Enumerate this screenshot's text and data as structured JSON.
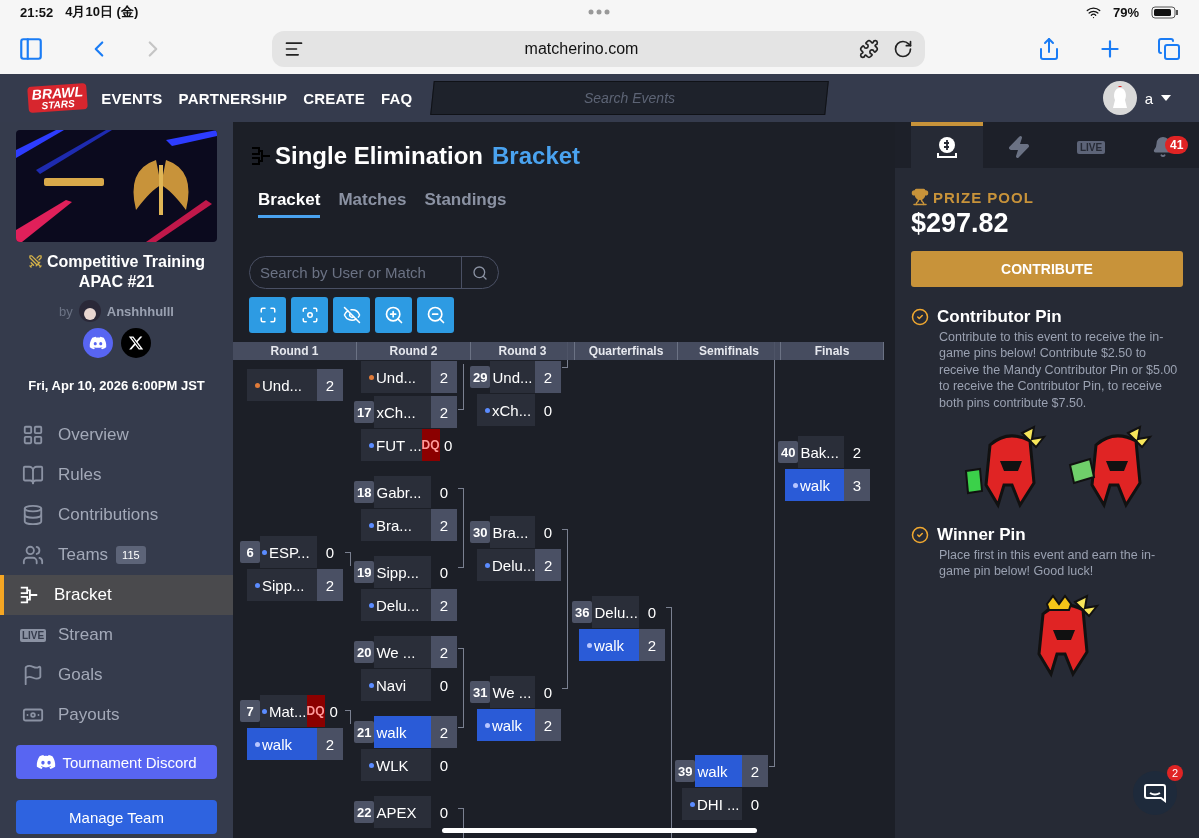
{
  "status_bar": {
    "time": "21:52",
    "date": "4月10日 (金)",
    "battery": "79%"
  },
  "browser": {
    "url": "matcherino.com"
  },
  "nav": {
    "logo": [
      "BRAWL",
      "STARS"
    ],
    "links": [
      "EVENTS",
      "PARTNERSHIP",
      "CREATE",
      "FAQ"
    ],
    "search": {
      "placeholder": "Search Events"
    },
    "user": "a"
  },
  "sidebar": {
    "event_title": "Competitive Training APAC #21",
    "by": "by",
    "organizer": "Anshhhulll",
    "date": "Fri, Apr 10, 2026 6:00PM JST",
    "items": [
      {
        "label": "Overview",
        "selected": false
      },
      {
        "label": "Rules",
        "selected": false
      },
      {
        "label": "Contributions",
        "selected": false
      },
      {
        "label": "Teams",
        "badge": "115",
        "selected": false
      },
      {
        "label": "Bracket",
        "selected": true
      },
      {
        "label": "Stream",
        "icon_text": "LIVE",
        "selected": false
      },
      {
        "label": "Goals",
        "selected": false
      },
      {
        "label": "Payouts",
        "selected": false
      }
    ],
    "buttons": [
      {
        "label": "Tournament Discord",
        "kind": "discord"
      },
      {
        "label": "Manage Team",
        "kind": "primary"
      }
    ]
  },
  "bracket": {
    "title": "Single Elimination",
    "title_accent": "Bracket",
    "tabs": [
      {
        "label": "Bracket",
        "selected": true
      },
      {
        "label": "Matches",
        "selected": false
      },
      {
        "label": "Standings",
        "selected": false
      }
    ],
    "search": {
      "placeholder": "Search by User or Match"
    },
    "rounds": [
      {
        "name": "Round 1",
        "matches": [
          {
            "rows": [
              {
                "team": "Und...",
                "score": "2",
                "color": "#e07b39",
                "winner": true,
                "highlighted": false
              }
            ]
          },
          {
            "number": "6",
            "rows": [
              {
                "team": "ESP...",
                "score": "0",
                "color": "#5b8cff",
                "winner": false,
                "highlighted": false
              },
              {
                "team": "Sipp...",
                "score": "2",
                "color": "#5b8cff",
                "winner": true,
                "highlighted": false
              }
            ]
          },
          {
            "number": "7",
            "rows": [
              {
                "team": "Mat...",
                "score": "0",
                "color": "#5b8cff",
                "winner": false,
                "highlighted": false,
                "tag": "DQ"
              },
              {
                "team": "walk",
                "score": "2",
                "color": "#b8c6ff",
                "winner": true,
                "highlighted": true
              }
            ]
          }
        ]
      },
      {
        "name": "Round 2",
        "matches": [
          {
            "rows": [
              {
                "team": "Und...",
                "score": "2",
                "color": "#e07b39",
                "winner": true,
                "highlighted": false
              }
            ]
          },
          {
            "number": "17",
            "rows": [
              {
                "team": "xCh...",
                "score": "2",
                "winner": true,
                "highlighted": false
              },
              {
                "team": "FUT ...",
                "score": "0",
                "color": "#5b8cff",
                "winner": false,
                "highlighted": false,
                "tag": "DQ"
              }
            ]
          },
          {
            "number": "18",
            "rows": [
              {
                "team": "Gabr...",
                "score": "0",
                "winner": false,
                "highlighted": false
              },
              {
                "team": "Bra...",
                "score": "2",
                "color": "#5b8cff",
                "winner": true,
                "highlighted": false
              }
            ]
          },
          {
            "number": "19",
            "rows": [
              {
                "team": "Sipp...",
                "score": "0",
                "winner": false,
                "highlighted": false
              },
              {
                "team": "Delu...",
                "score": "2",
                "color": "#5b8cff",
                "winner": true,
                "highlighted": false
              }
            ]
          },
          {
            "number": "20",
            "rows": [
              {
                "team": "We ...",
                "score": "2",
                "winner": true,
                "highlighted": false
              },
              {
                "team": "Navi",
                "score": "0",
                "color": "#5b8cff",
                "winner": false,
                "highlighted": false
              }
            ]
          },
          {
            "number": "21",
            "rows": [
              {
                "team": "walk",
                "score": "2",
                "winner": true,
                "highlighted": true
              },
              {
                "team": "WLK",
                "score": "0",
                "color": "#5b8cff",
                "winner": false,
                "highlighted": false
              }
            ]
          },
          {
            "number": "22",
            "rows": [
              {
                "team": "APEX",
                "score": "0",
                "winner": false,
                "highlighted": false
              }
            ]
          }
        ]
      },
      {
        "name": "Round 3",
        "matches": [
          {
            "number": "29",
            "rows": [
              {
                "team": "Und...",
                "score": "2",
                "winner": true,
                "highlighted": false
              },
              {
                "team": "xCh...",
                "score": "0",
                "color": "#5b8cff",
                "winner": false,
                "highlighted": false
              }
            ]
          },
          {
            "number": "30",
            "rows": [
              {
                "team": "Bra...",
                "score": "0",
                "winner": false,
                "highlighted": false
              },
              {
                "team": "Delu...",
                "score": "2",
                "color": "#5b8cff",
                "winner": true,
                "highlighted": false
              }
            ]
          },
          {
            "number": "31",
            "rows": [
              {
                "team": "We ...",
                "score": "0",
                "winner": false,
                "highlighted": false
              },
              {
                "team": "walk",
                "score": "2",
                "color": "#b8c6ff",
                "winner": true,
                "highlighted": true
              }
            ]
          }
        ]
      },
      {
        "name": "Quarterfinals",
        "matches": [
          {
            "number": "36",
            "rows": [
              {
                "team": "Delu...",
                "score": "0",
                "winner": false,
                "highlighted": false
              },
              {
                "team": "walk",
                "score": "2",
                "color": "#b8c6ff",
                "winner": true,
                "highlighted": true
              }
            ]
          }
        ]
      },
      {
        "name": "Semifinals",
        "matches": [
          {
            "number": "39",
            "rows": [
              {
                "team": "walk",
                "score": "2",
                "winner": true,
                "highlighted": true
              },
              {
                "team": "DHI ...",
                "score": "0",
                "color": "#5b8cff",
                "winner": false,
                "highlighted": false
              }
            ]
          }
        ]
      },
      {
        "name": "Finals",
        "matches": [
          {
            "number": "40",
            "rows": [
              {
                "team": "Bak...",
                "score": "2",
                "winner": false,
                "highlighted": false
              },
              {
                "team": "walk",
                "score": "3",
                "color": "#b8c6ff",
                "winner": true,
                "highlighted": true
              }
            ]
          }
        ]
      }
    ]
  },
  "prize_panel": {
    "tabs": [
      {
        "kind": "money",
        "selected": true
      },
      {
        "kind": "bolt",
        "selected": false
      },
      {
        "kind": "live",
        "label": "LIVE",
        "selected": false
      },
      {
        "kind": "bell",
        "badge": "41",
        "selected": false
      }
    ],
    "prize_label": "PRIZE POOL",
    "amount": "$297.82",
    "button": "CONTRIBUTE",
    "pins": [
      {
        "title": "Contributor Pin",
        "text": "Contribute to this event to receive the in-game pins below! Contribute $2.50 to receive the Mandy Contributor Pin or $5.00 to receive the Contributor Pin, to receive both pins contribute $7.50.",
        "stickers": [
          {
            "kind": "glove"
          },
          {
            "kind": "cash"
          }
        ]
      },
      {
        "title": "Winner Pin",
        "text": "Place first in this event and earn the in-game pin below! Good luck!",
        "stickers": [
          {
            "kind": "crown"
          }
        ]
      }
    ]
  },
  "chat": {
    "badge": "2"
  }
}
